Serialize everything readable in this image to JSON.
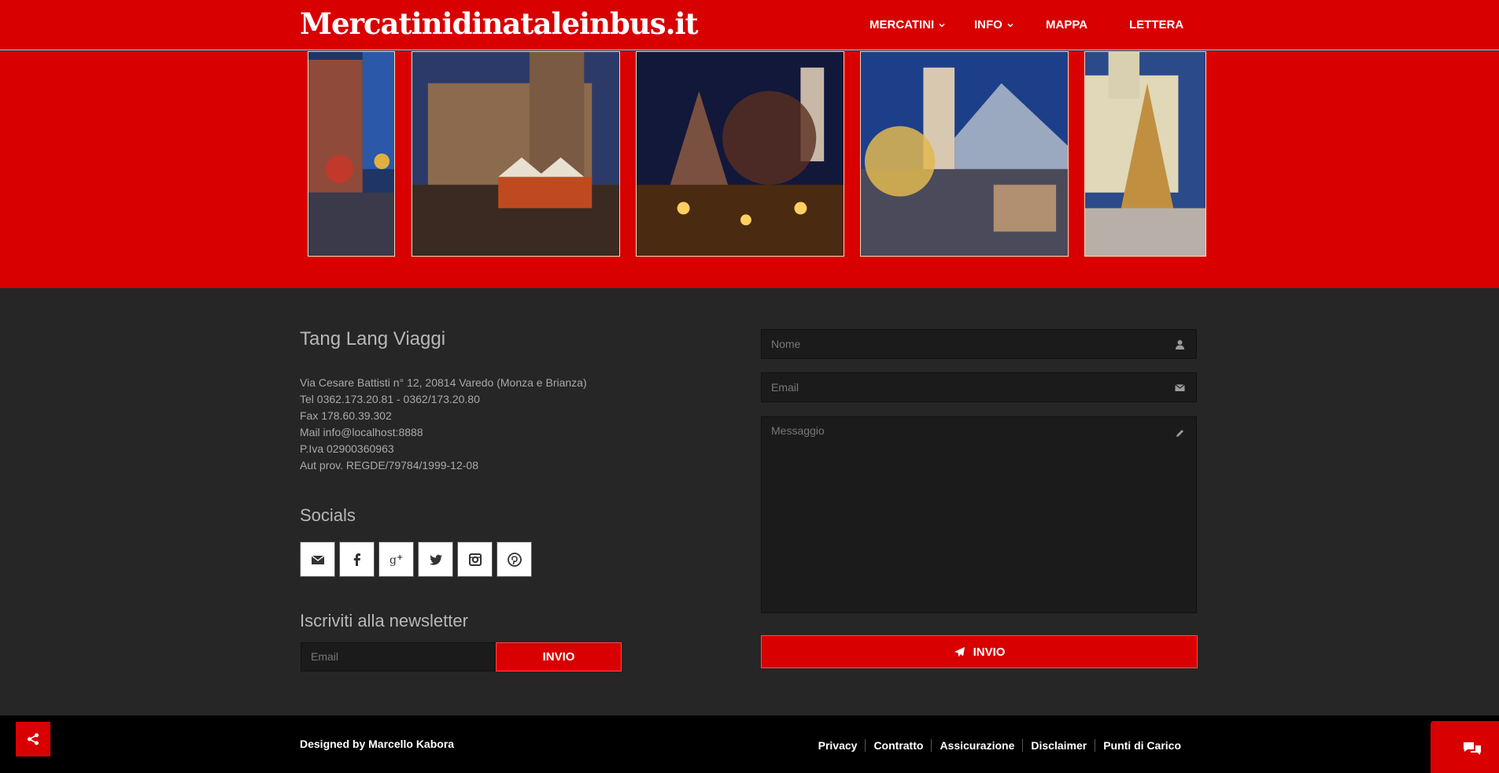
{
  "header": {
    "logo": "Mercatinidinataleinbus.it",
    "nav": [
      {
        "label": "MERCATINI",
        "has_dropdown": true
      },
      {
        "label": "INFO",
        "has_dropdown": true
      },
      {
        "label": "MAPPA",
        "has_dropdown": false
      },
      {
        "label": "LETTERA",
        "has_dropdown": false
      }
    ]
  },
  "banner": {
    "slides": [
      "christmas-market-photo",
      "christmas-market-photo",
      "christmas-market-photo",
      "christmas-market-photo",
      "christmas-market-photo"
    ]
  },
  "company": {
    "name": "Tang Lang Viaggi",
    "lines": [
      "Via Cesare Battisti n° 12, 20814 Varedo (Monza e Brianza)",
      "Tel 0362.173.20.81 - 0362/173.20.80",
      "Fax 178.60.39.302",
      "Mail info@localhost:8888",
      "P.Iva 02900360963",
      "Aut prov. REGDE/79784/1999-12-08"
    ]
  },
  "socials": {
    "heading": "Socials",
    "icons": [
      "envelope-icon",
      "facebook-icon",
      "google-plus-icon",
      "twitter-icon",
      "instagram-icon",
      "pinterest-icon"
    ]
  },
  "newsletter": {
    "heading": "Iscriviti alla newsletter",
    "placeholder": "Email",
    "button": "INVIO"
  },
  "contact_form": {
    "name_placeholder": "Nome",
    "email_placeholder": "Email",
    "message_placeholder": "Messaggio",
    "button": "INVIO"
  },
  "footer": {
    "designed_by": "Designed by Marcello Kabora",
    "links": [
      "Privacy",
      "Contratto",
      "Assicurazione",
      "Disclaimer",
      "Punti di Carico"
    ]
  },
  "colors": {
    "brand_red": "#d80000",
    "dark_bg": "#262626",
    "footer_bg": "#000000"
  }
}
